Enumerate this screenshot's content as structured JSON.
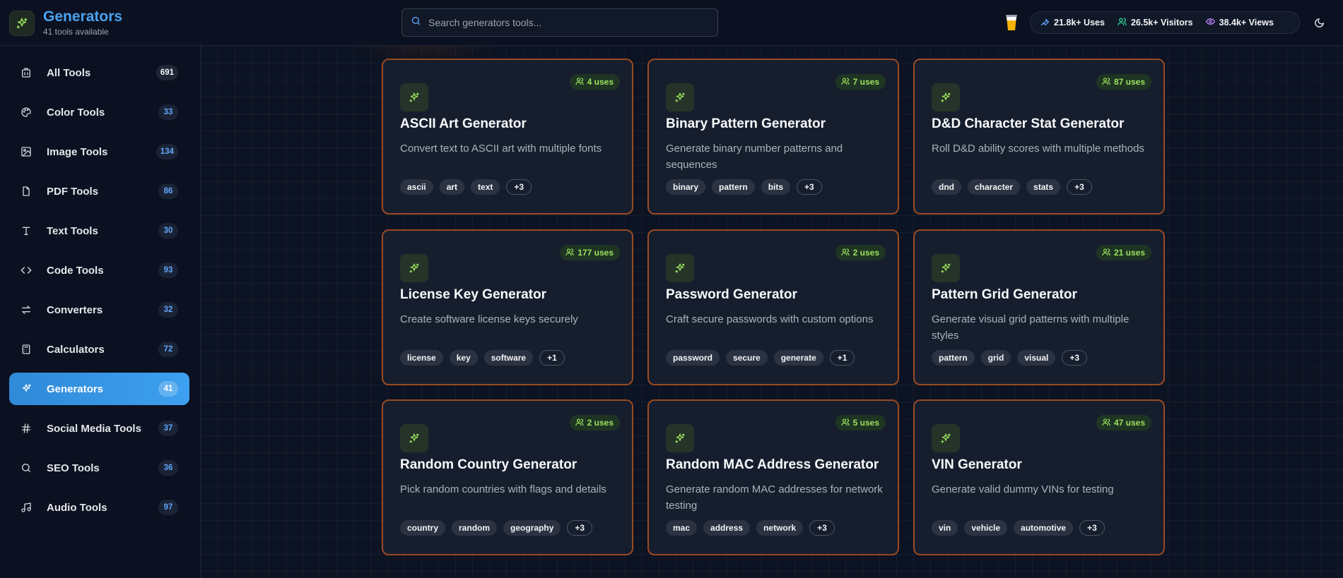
{
  "brand": {
    "title": "Generators",
    "subtitle": "41 tools available"
  },
  "search": {
    "placeholder": "Search generators tools..."
  },
  "stats": {
    "uses": "21.8k+ Uses",
    "visitors": "26.5k+ Visitors",
    "views": "38.4k+ Views"
  },
  "sidebar": {
    "items": [
      {
        "label": "All Tools",
        "count": "691",
        "icon": "grid-icon"
      },
      {
        "label": "Color Tools",
        "count": "33",
        "icon": "palette-icon"
      },
      {
        "label": "Image Tools",
        "count": "134",
        "icon": "image-icon"
      },
      {
        "label": "PDF Tools",
        "count": "86",
        "icon": "file-icon"
      },
      {
        "label": "Text Tools",
        "count": "30",
        "icon": "type-icon"
      },
      {
        "label": "Code Tools",
        "count": "93",
        "icon": "code-icon"
      },
      {
        "label": "Converters",
        "count": "32",
        "icon": "arrows-icon"
      },
      {
        "label": "Calculators",
        "count": "72",
        "icon": "calculator-icon"
      },
      {
        "label": "Generators",
        "count": "41",
        "icon": "sparkles-icon",
        "active": true
      },
      {
        "label": "Social Media Tools",
        "count": "37",
        "icon": "hash-icon"
      },
      {
        "label": "SEO Tools",
        "count": "36",
        "icon": "search-icon"
      },
      {
        "label": "Audio Tools",
        "count": "97",
        "icon": "music-icon"
      }
    ]
  },
  "cards": [
    {
      "title": "ASCII Art Generator",
      "desc": "Convert text to ASCII art with multiple fonts",
      "uses": "4 uses",
      "tags": [
        "ascii",
        "art",
        "text",
        "+3"
      ]
    },
    {
      "title": "Binary Pattern Generator",
      "desc": "Generate binary number patterns and sequences",
      "uses": "7 uses",
      "tags": [
        "binary",
        "pattern",
        "bits",
        "+3"
      ]
    },
    {
      "title": "D&D Character Stat Generator",
      "desc": "Roll D&D ability scores with multiple methods",
      "uses": "87 uses",
      "tags": [
        "dnd",
        "character",
        "stats",
        "+3"
      ]
    },
    {
      "title": "License Key Generator",
      "desc": "Create software license keys securely",
      "uses": "177 uses",
      "tags": [
        "license",
        "key",
        "software",
        "+1"
      ]
    },
    {
      "title": "Password Generator",
      "desc": "Craft secure passwords with custom options",
      "uses": "2 uses",
      "tags": [
        "password",
        "secure",
        "generate",
        "+1"
      ]
    },
    {
      "title": "Pattern Grid Generator",
      "desc": "Generate visual grid patterns with multiple styles",
      "uses": "21 uses",
      "tags": [
        "pattern",
        "grid",
        "visual",
        "+3"
      ]
    },
    {
      "title": "Random Country Generator",
      "desc": "Pick random countries with flags and details",
      "uses": "2 uses",
      "tags": [
        "country",
        "random",
        "geography",
        "+3"
      ]
    },
    {
      "title": "Random MAC Address Generator",
      "desc": "Generate random MAC addresses for network testing",
      "uses": "5 uses",
      "tags": [
        "mac",
        "address",
        "network",
        "+3"
      ]
    },
    {
      "title": "VIN Generator",
      "desc": "Generate valid dummy VINs for testing",
      "uses": "47 uses",
      "tags": [
        "vin",
        "vehicle",
        "automotive",
        "+3"
      ]
    }
  ],
  "colors": {
    "accent": "#3ea0f0",
    "card_border": "#9a4a22",
    "uses_green": "#9be15d"
  }
}
